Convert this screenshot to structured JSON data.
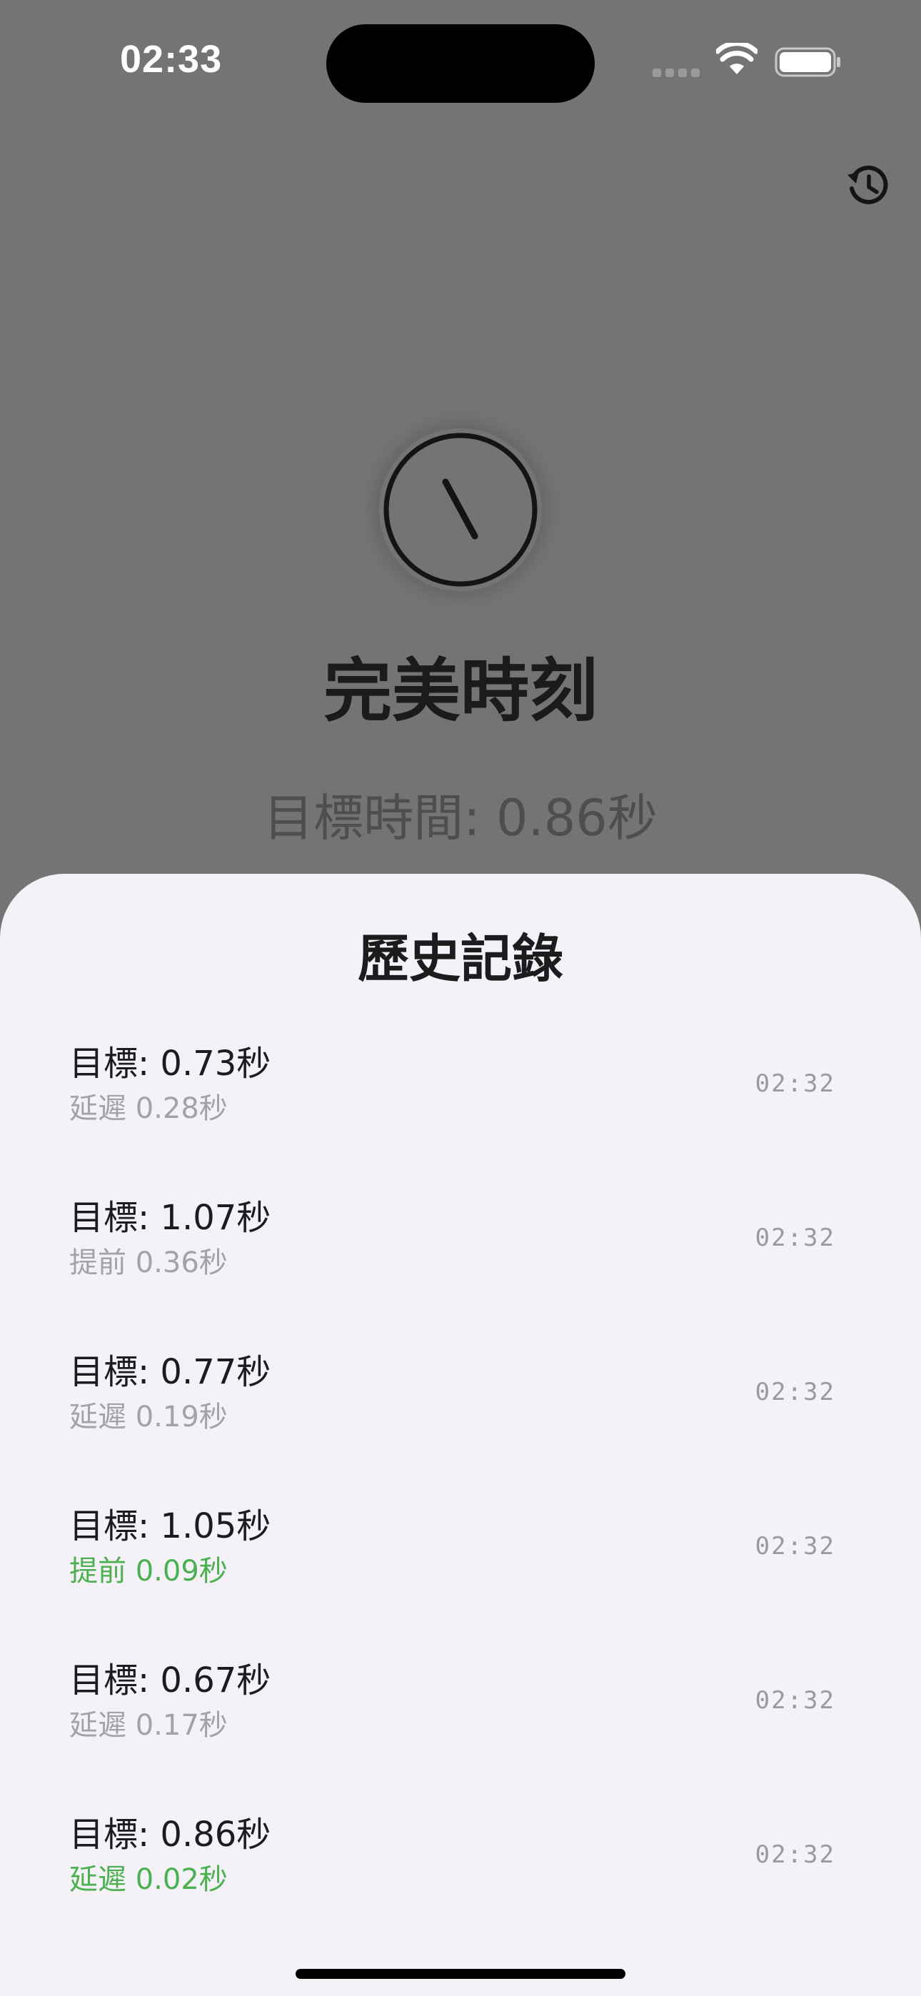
{
  "status_bar": {
    "time": "02:33",
    "icons": [
      "signal-dots-icon",
      "wifi-icon",
      "battery-icon"
    ]
  },
  "toolbar": {
    "history_icon": "history-clock-icon"
  },
  "clock_icon": "clock-icon",
  "main": {
    "title": "完美時刻",
    "target_label": "目標時間: 0.86秒"
  },
  "sheet": {
    "title": "歷史記錄",
    "items": [
      {
        "target": "目標: 0.73秒",
        "result": "延遲 0.28秒",
        "time": "02:32",
        "good": false
      },
      {
        "target": "目標: 1.07秒",
        "result": "提前 0.36秒",
        "time": "02:32",
        "good": false
      },
      {
        "target": "目標: 0.77秒",
        "result": "延遲 0.19秒",
        "time": "02:32",
        "good": false
      },
      {
        "target": "目標: 1.05秒",
        "result": "提前 0.09秒",
        "time": "02:32",
        "good": true
      },
      {
        "target": "目標: 0.67秒",
        "result": "延遲 0.17秒",
        "time": "02:32",
        "good": false
      },
      {
        "target": "目標: 0.86秒",
        "result": "延遲 0.02秒",
        "time": "02:32",
        "good": true
      }
    ]
  },
  "colors": {
    "good": "#4cb050",
    "neutral": "#a2a2a7",
    "dim_background": "#747474",
    "sheet_background": "#f4f1f7"
  }
}
